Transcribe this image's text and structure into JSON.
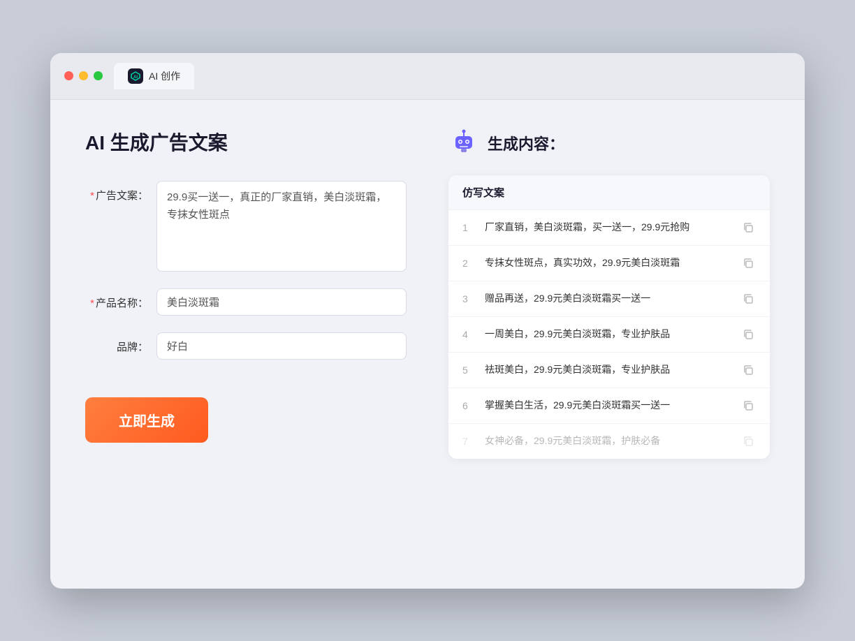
{
  "window": {
    "tab_label": "AI 创作",
    "tab_icon": "AI"
  },
  "left_panel": {
    "title": "AI 生成广告文案",
    "ad_copy_label": "广告文案：",
    "ad_copy_required": true,
    "ad_copy_value": "29.9买一送一，真正的厂家直销，美白淡斑霜，专抹女性斑点",
    "product_name_label": "产品名称：",
    "product_name_required": true,
    "product_name_value": "美白淡斑霜",
    "brand_label": "品牌：",
    "brand_required": false,
    "brand_value": "好白",
    "generate_button": "立即生成"
  },
  "right_panel": {
    "title": "生成内容：",
    "table_header": "仿写文案",
    "results": [
      {
        "num": 1,
        "text": "厂家直销，美白淡斑霜，买一送一，29.9元抢购"
      },
      {
        "num": 2,
        "text": "专抹女性斑点，真实功效，29.9元美白淡斑霜"
      },
      {
        "num": 3,
        "text": "赠品再送，29.9元美白淡斑霜买一送一"
      },
      {
        "num": 4,
        "text": "一周美白，29.9元美白淡斑霜，专业护肤品"
      },
      {
        "num": 5,
        "text": "祛斑美白，29.9元美白淡斑霜，专业护肤品"
      },
      {
        "num": 6,
        "text": "掌握美白生活，29.9元美白淡斑霜买一送一"
      },
      {
        "num": 7,
        "text": "女神必备，29.9元美白淡斑霜，护肤必备",
        "faded": true
      }
    ]
  }
}
